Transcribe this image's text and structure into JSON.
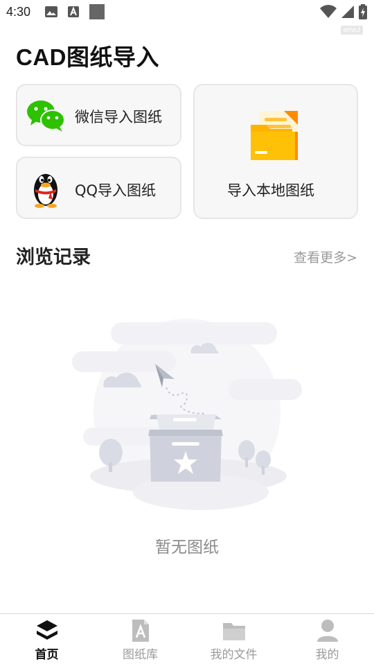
{
  "status_bar": {
    "time": "4:30",
    "watermark": "ameJ"
  },
  "page_title": "CAD图纸导入",
  "import_cards": {
    "wechat": {
      "label": "微信导入图纸",
      "icon": "wechat-icon"
    },
    "qq": {
      "label": "QQ导入图纸",
      "icon": "qq-penguin-icon"
    },
    "local": {
      "label": "导入本地图纸",
      "icon": "folder-icon"
    }
  },
  "history": {
    "title": "浏览记录",
    "more_link": "查看更多>",
    "empty_text": "暂无图纸"
  },
  "tab_bar": {
    "items": [
      {
        "label": "首页",
        "icon": "home-layers-icon",
        "active": true
      },
      {
        "label": "图纸库",
        "icon": "drawing-library-icon",
        "active": false
      },
      {
        "label": "我的文件",
        "icon": "folder-icon",
        "active": false
      },
      {
        "label": "我的",
        "icon": "user-icon",
        "active": false
      }
    ]
  },
  "colors": {
    "wechat_green": "#2dc100",
    "folder_yellow": "#ffb300",
    "card_bg": "#f7f7f7",
    "inactive_tab": "#9a9a9a"
  }
}
